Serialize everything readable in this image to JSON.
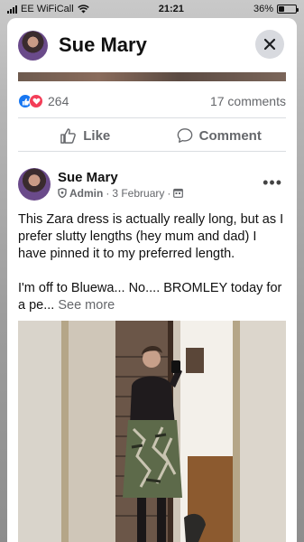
{
  "status_bar": {
    "carrier": "EE WiFiCall",
    "time": "21:21",
    "battery_pct": "36%",
    "battery_level": 0.36
  },
  "header": {
    "title": "Sue Mary",
    "close_icon": "close-icon"
  },
  "reactions": {
    "count": "264",
    "comments": "17 comments",
    "icons": [
      "like-icon",
      "love-icon"
    ]
  },
  "actions": {
    "like_label": "Like",
    "comment_label": "Comment"
  },
  "post": {
    "author": "Sue Mary",
    "role": "Admin",
    "date": "3 February",
    "separator": "·",
    "paragraph1": "This Zara dress is actually really long, but as I prefer slutty lengths (hey mum and dad) I have pinned it to my preferred length.",
    "paragraph2": "I'm off to Bluewa... No.... BROMLEY today for a pe...",
    "see_more": "See more"
  },
  "colors": {
    "accent": "#1877f2",
    "love": "#f33e58",
    "muted": "#65676b"
  }
}
